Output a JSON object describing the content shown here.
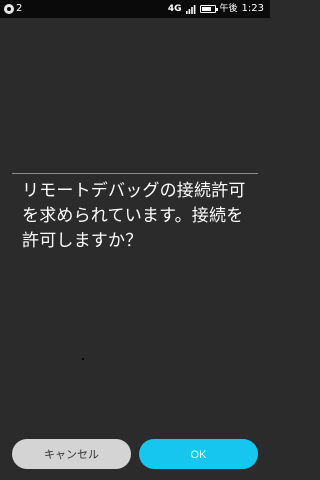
{
  "status_bar": {
    "notification_icon": "notification-icon",
    "notification_count": "2",
    "network_type": "4G",
    "signal_icon": "signal-icon",
    "battery_icon": "battery-icon",
    "battery_level": 0.8,
    "clock_prefix": "午後",
    "clock_time": "1:23"
  },
  "dialog": {
    "message": "リモートデバッグの接続許可\nを求められています。接続を\n許可しますか？",
    "cancel_label": "キャンセル",
    "ok_label": "OK"
  },
  "colors": {
    "background": "#2b2b2b",
    "status_bar": "#0a0a0a",
    "ok_button": "#16c6ee",
    "cancel_button": "#d4d4d4"
  }
}
